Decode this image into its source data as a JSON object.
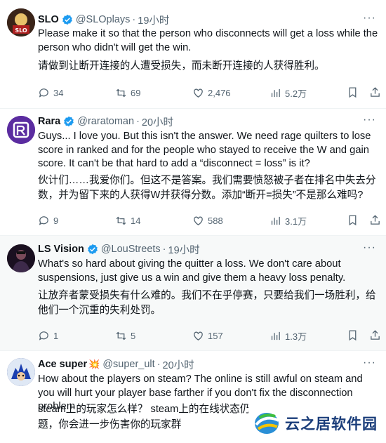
{
  "tweets": [
    {
      "name": "SLO",
      "handle": "@SLOplays",
      "time": "19小时",
      "more": "···",
      "text": "Please make it so that the person who disconnects will get a loss while the person who didn't will get the win.",
      "zh": "请做到让断开连接的人遭受损失，而未断开连接的人获得胜利。",
      "stats": {
        "replies": "34",
        "retweets": "69",
        "likes": "2,476",
        "views": "5.2万"
      },
      "icons": {
        "avatar": "avatar-slo",
        "verified": "verified-badge-icon"
      }
    },
    {
      "name": "Rara",
      "handle": "@raratoman",
      "time": "20小时",
      "more": "···",
      "text": "Guys... I love you. But this isn't the answer. We need rage quilters to lose score in ranked and for the people who stayed to receive the W and gain score. It can't be that hard to add a “disconnect = loss” is it?",
      "zh": "伙计们……我爱你们。但这不是答案。我们需要愤怒被子者在排名中失去分数，并为留下来的人获得W并获得分数。添加“断开=损失”不是那么难吗?",
      "stats": {
        "replies": "9",
        "retweets": "14",
        "likes": "588",
        "views": "3.1万"
      },
      "icons": {
        "avatar": "avatar-rara",
        "verified": "verified-badge-icon"
      }
    },
    {
      "name": "LS Vision",
      "handle": "@LouStreets",
      "time": "19小时",
      "more": "···",
      "text": "What's so hard about giving the quitter a loss. We don't care about suspensions, just give us a win and give them a heavy loss penalty.",
      "zh": "让放弃者蒙受损失有什么难的。我们不在乎停赛，只要给我们一场胜利，给他们一个沉重的失利处罚。",
      "stats": {
        "replies": "1",
        "retweets": "5",
        "likes": "157",
        "views": "1.3万"
      },
      "icons": {
        "avatar": "avatar-ls",
        "verified": "verified-badge-icon"
      }
    },
    {
      "name": "Ace super",
      "emoji": "💥",
      "handle": "@super_ult",
      "time": "20小时",
      "more": "···",
      "text": "How about the players on steam? The online is still awful on steam and you will hurt your player base farther if you don't fix the disconnection problem",
      "zh": "steam上的玩家怎么样？ steam上的在线状态仍",
      "zh2": "题，你会进一步伤害你的玩家群",
      "icons": {
        "avatar": "avatar-ace"
      }
    }
  ],
  "watermark": {
    "text": "云之居软件园"
  },
  "colors": {
    "verified": "#1d9bf0",
    "secondary": "#536471",
    "highlight_bg": "#f7f9f9"
  }
}
